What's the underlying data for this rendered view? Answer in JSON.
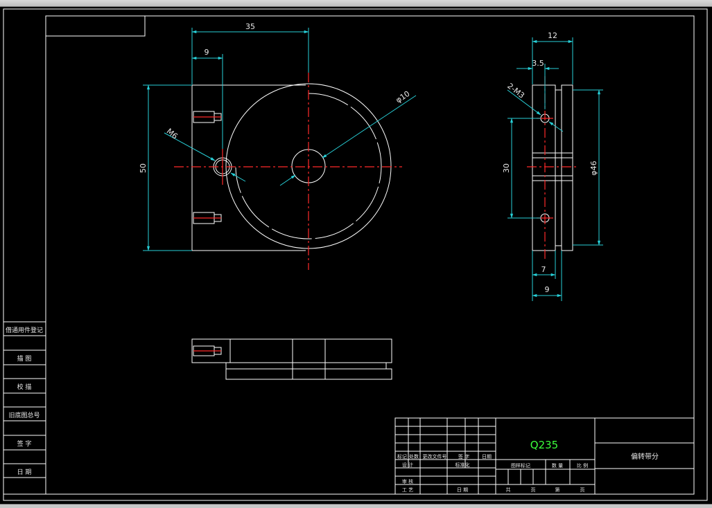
{
  "window": {
    "title_bar": ""
  },
  "dimensions": {
    "top_width": "35",
    "hole_offset": "9",
    "height": "50",
    "thread": "M6",
    "bore": "φ10",
    "side_width": "12",
    "side_offset": "3.5",
    "holes": "2-M3",
    "hole_spacing": "30",
    "outer_diameter": "φ46",
    "bottom_a": "7",
    "bottom_b": "9"
  },
  "side_table": [
    "借通用件登记",
    "描 图",
    "校 描",
    "旧底图总号",
    "签 字",
    "日 期"
  ],
  "title_block": {
    "material": "Q235",
    "part_name": "偏转带分",
    "row_headers": [
      "标记",
      "处数",
      "更改文件号",
      "签 字",
      "日期"
    ],
    "design": "设 计",
    "standardization": "标准化",
    "review": "审 核",
    "process": "工 艺",
    "date": "日 期",
    "stage_mark": "图样标记",
    "weight": "数 量",
    "scale": "比 例",
    "total": "共",
    "sheet_word": "页",
    "page_no": "第",
    "sheet_word2": "页"
  },
  "colors": {
    "linework": "#ffffff",
    "dimensions": "#28d0d8",
    "centerlines": "#ff2a2a",
    "material_text": "#3cff3c"
  }
}
